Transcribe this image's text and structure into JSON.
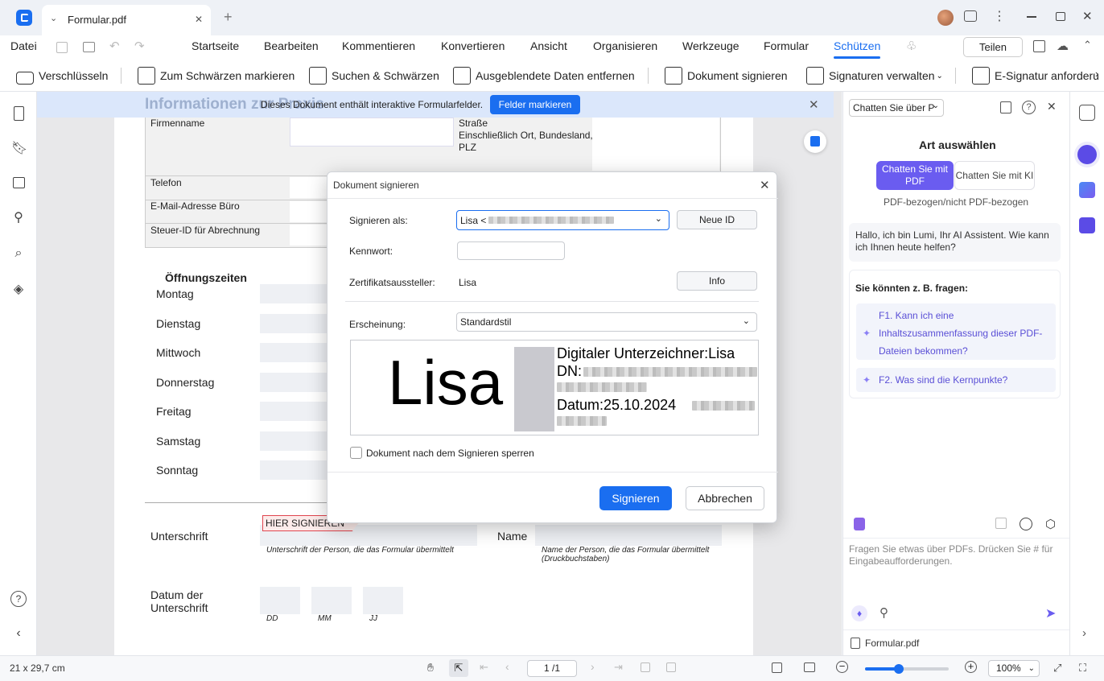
{
  "titlebar": {
    "tab_title": "Formular.pdf",
    "close_tab": "✕",
    "new_tab": "+"
  },
  "menu": {
    "file": "Datei",
    "items": [
      "Startseite",
      "Bearbeiten",
      "Kommentieren",
      "Konvertieren",
      "Ansicht",
      "Organisieren",
      "Werkzeuge",
      "Formular",
      "Schützen"
    ],
    "active": "Schützen",
    "share": "Teilen"
  },
  "toolbar": {
    "encrypt": "Verschlüsseln",
    "mark_redact": "Zum Schwärzen markieren",
    "search_redact": "Suchen & Schwärzen",
    "remove_hidden": "Ausgeblendete Daten entfernen",
    "sign_doc": "Dokument signieren",
    "manage_sigs": "Signaturen verwalten",
    "request_esig": "E-Signatur anforderu"
  },
  "infobar": {
    "message": "Dieses Dokument enthält interaktive Formularfelder.",
    "button": "Felder markieren",
    "behind_title": "Informationen zur Praxis"
  },
  "form": {
    "firmenname": "Firmenname",
    "strasse": "Straße",
    "ort": "Einschließlich Ort, Bundesland,",
    "plz": "PLZ",
    "telefon": "Telefon",
    "email": "E-Mail-Adresse Büro",
    "steuer": "Steuer-ID für Abrechnung",
    "hours_title": "Öffnungszeiten",
    "days": [
      "Montag",
      "Dienstag",
      "Mittwoch",
      "Donnerstag",
      "Freitag",
      "Samstag",
      "Sonntag"
    ],
    "signature_label": "Unterschrift",
    "sign_here": "HIER SIGNIEREN",
    "signature_hint": "Unterschrift der Person, die das Formular übermittelt",
    "name_label": "Name",
    "name_hint": "Name der Person, die das Formular übermittelt (Druckbuchstaben)",
    "date_label": "Datum der Unterschrift",
    "date_parts": [
      "DD",
      "MM",
      "JJ"
    ]
  },
  "dialog": {
    "title": "Dokument signieren",
    "sign_as_label": "Signieren als:",
    "sign_as_value": "Lisa <",
    "new_id": "Neue ID",
    "password_label": "Kennwort:",
    "issuer_label": "Zertifikatsaussteller:",
    "issuer_value": "Lisa",
    "info": "Info",
    "appearance_label": "Erscheinung:",
    "appearance_value": "Standardstil",
    "preview_name": "Lisa",
    "preview_signer": "Digitaler Unterzeichner:Lisa",
    "preview_dn": "DN:",
    "preview_date": "Datum:25.10.2024",
    "lock_label": "Dokument nach dem Signieren sperren",
    "lock_checked": false,
    "sign_button": "Signieren",
    "cancel_button": "Abbrechen"
  },
  "panel": {
    "dropdown": "Chatten Sie über P",
    "heading": "Art auswählen",
    "mode_pdf": "Chatten Sie mit PDF",
    "mode_ai": "Chatten Sie mit KI",
    "mode_note": "PDF-bezogen/nicht PDF-bezogen",
    "greeting": "Hallo, ich bin Lumi, Ihr AI Assistent. Wie kann ich Ihnen heute helfen?",
    "suggest_title": "Sie könnten z. B. fragen:",
    "questions": [
      "F1. Kann ich eine Inhaltszusammenfassung dieser PDF-Dateien bekommen?",
      "F2. Was sind die Kernpunkte?"
    ],
    "input_placeholder": "Fragen Sie etwas über PDFs. Drücken Sie # für Eingabeaufforderungen.",
    "file": "Formular.pdf"
  },
  "status": {
    "page_size": "21 x 29,7 cm",
    "page": "1 /1",
    "zoom": "100%",
    "zoom_level": 0.4
  },
  "colors": {
    "accent": "#1a6ef0",
    "active_tab": "#1a6ef0",
    "sign_tag": "#e0454f",
    "ai_purple": "#6a5cf0"
  }
}
